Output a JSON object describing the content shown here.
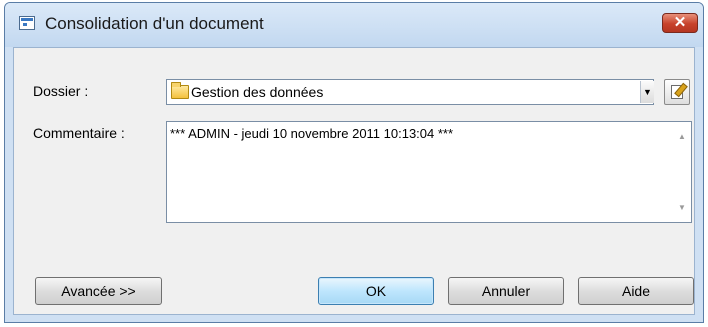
{
  "window": {
    "title": "Consolidation d'un document",
    "close_label": "✕"
  },
  "form": {
    "folder_label": "Dossier :",
    "folder_value": "Gestion des données",
    "comment_label": "Commentaire :",
    "comment_value": "*** ADMIN - jeudi 10 novembre 2011 10:13:04 ***"
  },
  "buttons": {
    "advanced": "Avancée >>",
    "ok": "OK",
    "cancel": "Annuler",
    "help": "Aide"
  },
  "icons": {
    "app": "app-window-icon",
    "folder": "folder-icon",
    "dropdown": "dropdown-arrow-icon",
    "properties": "properties-icon"
  }
}
